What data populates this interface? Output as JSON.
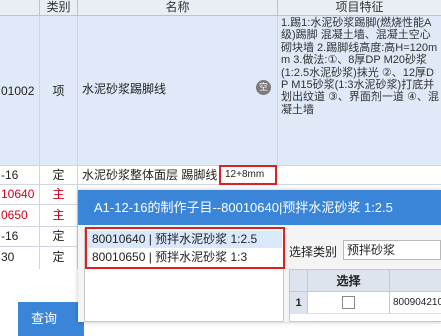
{
  "table": {
    "headers": {
      "category": "类别",
      "name": "名称",
      "feature": "项目特征"
    },
    "rows": [
      {
        "code": "01002",
        "category": "项",
        "name": "水泥砂浆踢脚线",
        "badge": "空",
        "feature": "1.踢1:水泥砂浆踢脚(燃烧性能A级)踢脚 混凝土墙、混凝土空心砌块墙 2.踢脚线高度:高H=120mm 3.做法:①、8厚DP M20砂浆(1:2.5水泥砂浆)抹光 ②、12厚DP M15砂浆(1:3水泥砂浆)打底并划出纹道 ③、界面剂一道 ④、混凝土墙"
      },
      {
        "code": "-16",
        "category": "定",
        "name": "水泥砂浆整体面层 踢脚线",
        "highlight": "12+8mm"
      },
      {
        "code": "10640",
        "category": "主"
      },
      {
        "code": "0650",
        "category": "主"
      },
      {
        "code": "-16",
        "category": "定"
      },
      {
        "code": "30",
        "category": "定"
      }
    ]
  },
  "popup": {
    "title": "A1-12-16的制作子目--80010640|预拌水泥砂浆 1:2.5",
    "options": [
      "80010640 | 预拌水泥砂浆 1:2.5",
      "80010650 | 预拌水泥砂浆 1:3"
    ],
    "filter_label": "选择类别",
    "filter_value": "预拌砂浆",
    "grid": {
      "select_header": "选择",
      "row_number": "1",
      "code_partial": "800904210"
    }
  },
  "query_label": "查询",
  "colors": {
    "accent": "#3b85d9",
    "highlight_border": "#e02020"
  }
}
